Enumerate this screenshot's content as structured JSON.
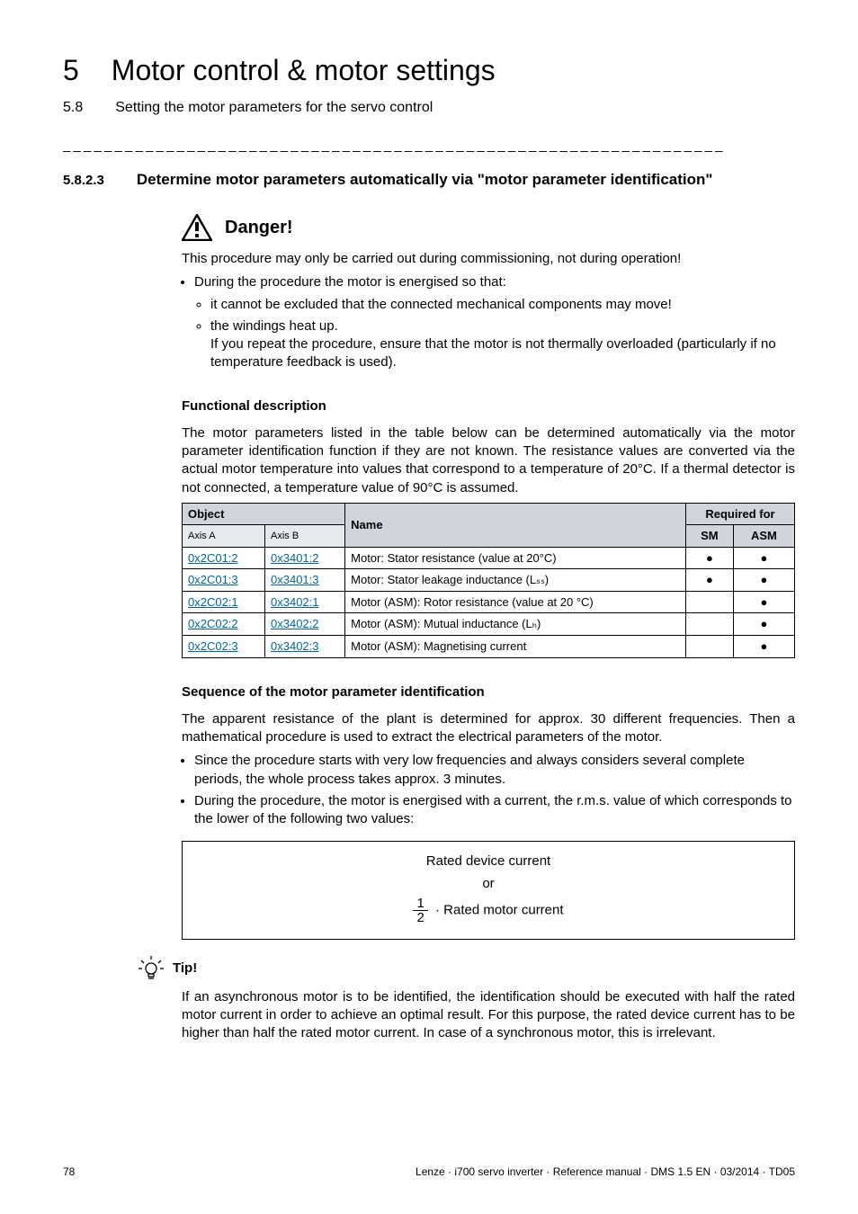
{
  "header": {
    "chapter_num": "5",
    "chapter_title": "Motor control & motor settings",
    "section_num": "5.8",
    "section_title": "Setting the motor parameters for the servo control",
    "rule": "_ _ _ _ _ _ _ _ _ _ _ _ _ _ _ _ _ _ _ _ _ _ _ _ _ _ _ _ _ _ _ _ _ _ _ _ _ _ _ _ _ _ _ _ _ _ _ _ _ _ _ _ _ _ _ _ _ _ _ _ _ _ _ _"
  },
  "h3": {
    "num": "5.8.2.3",
    "title": "Determine motor parameters automatically via \"motor parameter identification\""
  },
  "danger": {
    "title": "Danger!",
    "lead": "This procedure may only be carried out during commissioning, not during operation!",
    "b1": "During the procedure the motor is energised so that:",
    "b1a": "it cannot be excluded that the connected mechanical components may move!",
    "b1b": "the windings heat up.",
    "b1b_cont": "If you repeat the procedure, ensure that the motor is not thermally overloaded (particularly if no temperature feedback is used)."
  },
  "fd": {
    "title": "Functional description",
    "para": "The motor parameters listed in the table below can be determined automatically via the motor parameter identification function if they are not known. The resistance values are converted via the actual motor temperature into values that correspond to a temperature of 20°C. If a thermal detector is not connected, a temperature value of 90°C is assumed."
  },
  "table": {
    "head": {
      "object": "Object",
      "name": "Name",
      "req": "Required for",
      "axisA": "Axis A",
      "axisB": "Axis B",
      "sm": "SM",
      "asm": "ASM"
    },
    "rows": [
      {
        "a": "0x2C01:2",
        "b": "0x3401:2",
        "name": "Motor: Stator resistance (value at 20°C)",
        "sm": "●",
        "asm": "●"
      },
      {
        "a": "0x2C01:3",
        "b": "0x3401:3",
        "name": "Motor: Stator leakage inductance (Lₛₛ)",
        "sm": "●",
        "asm": "●"
      },
      {
        "a": "0x2C02:1",
        "b": "0x3402:1",
        "name": "Motor (ASM): Rotor resistance (value at 20 °C)",
        "sm": "",
        "asm": "●"
      },
      {
        "a": "0x2C02:2",
        "b": "0x3402:2",
        "name": "Motor (ASM): Mutual inductance (Lₕ)",
        "sm": "",
        "asm": "●"
      },
      {
        "a": "0x2C02:3",
        "b": "0x3402:3",
        "name": "Motor (ASM): Magnetising current",
        "sm": "",
        "asm": "●"
      }
    ]
  },
  "seq": {
    "title": "Sequence of the motor parameter identification",
    "para": "The apparent resistance of the plant is determined for approx. 30 different frequencies. Then a mathematical procedure is used to extract the electrical parameters of the motor.",
    "b1": "Since the procedure starts with very low frequencies and always considers several complete periods, the whole process takes approx. 3 minutes.",
    "b2": "During the procedure, the motor is energised with a current, the r.m.s. value of which corresponds to the lower of the following two values:"
  },
  "formula": {
    "line1": "Rated device current",
    "or": "or",
    "frac_num": "1",
    "frac_den": "2",
    "line2_rest": " · Rated motor current"
  },
  "tip": {
    "title": "Tip!",
    "para": "If an asynchronous motor is to be identified, the identification should be executed with half the rated motor current in order to achieve an optimal result. For this purpose, the rated device current has to be higher than half the rated motor current. In case of a synchronous motor, this is irrelevant."
  },
  "footer": {
    "page": "78",
    "meta": "Lenze · i700 servo inverter · Reference manual · DMS 1.5 EN · 03/2014 · TD05"
  }
}
